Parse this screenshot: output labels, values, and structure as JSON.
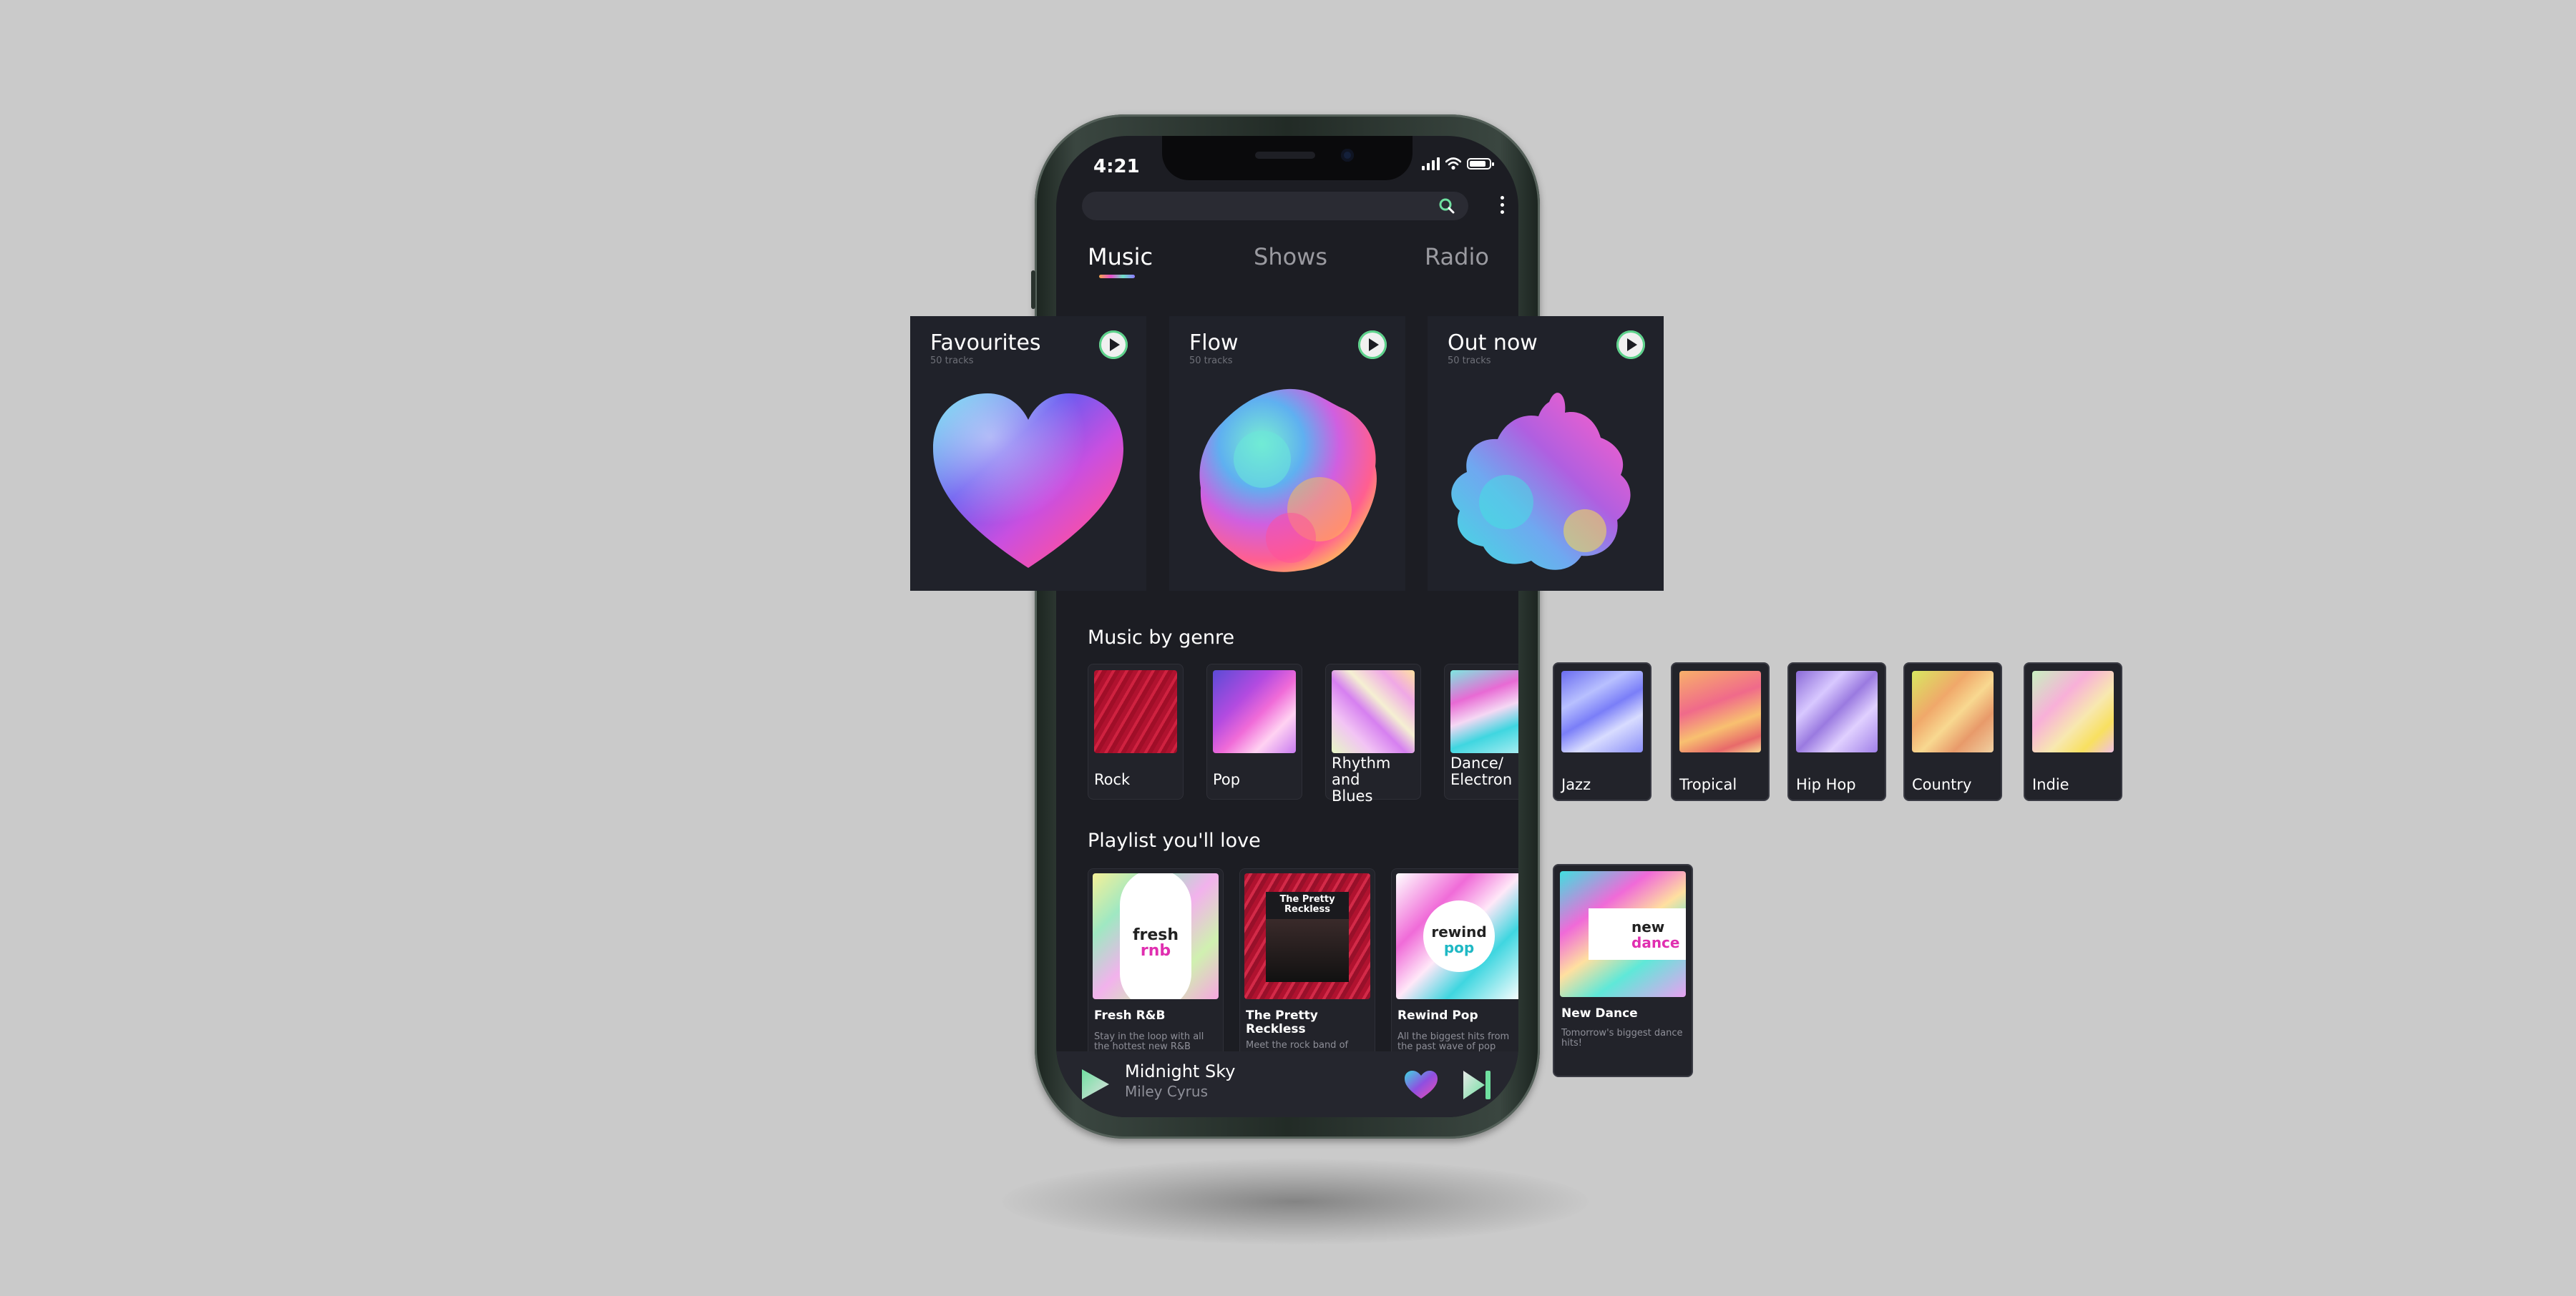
{
  "status": {
    "time": "4:21"
  },
  "tabs": [
    {
      "label": "Music",
      "active": true
    },
    {
      "label": "Shows",
      "active": false
    },
    {
      "label": "Radio",
      "active": false
    }
  ],
  "mixes": [
    {
      "title": "Favourites",
      "subtitle": "50 tracks"
    },
    {
      "title": "Flow",
      "subtitle": "50 tracks"
    },
    {
      "title": "Out now",
      "subtitle": "50 tracks"
    }
  ],
  "genre_section": {
    "title": "Music by genre",
    "items": [
      {
        "label": "Rock"
      },
      {
        "label": "Pop"
      },
      {
        "label": "Rhythm and Blues"
      },
      {
        "label": "Dance/ Electron"
      },
      {
        "label": "Jazz"
      },
      {
        "label": "Tropical"
      },
      {
        "label": "Hip Hop"
      },
      {
        "label": "Country"
      },
      {
        "label": "Indie"
      }
    ]
  },
  "playlist_section": {
    "title": "Playlist you'll love",
    "items": [
      {
        "title": "Fresh R&B",
        "description": "Stay in the loop with all the hottest new R&B",
        "art_top": "fresh",
        "art_bottom": "rnb"
      },
      {
        "title": "The Pretty Reckless",
        "description": "Meet the rock band of",
        "art_top": "The Pretty",
        "art_bottom": "Reckless"
      },
      {
        "title": "Rewind Pop",
        "description": "All the biggest hits from the past wave of pop",
        "art_top": "rewind",
        "art_bottom": "pop"
      },
      {
        "title": "New Dance",
        "description": "Tomorrow's biggest dance hits!",
        "art_top": "new",
        "art_bottom": "dance"
      }
    ]
  },
  "player": {
    "title": "Midnight Sky",
    "artist": "Miley Cyrus"
  },
  "colors": {
    "background": "#cacaca",
    "screen": "#1c1d23",
    "card": "#22232a",
    "accent": "#5bd28a"
  },
  "icons": [
    "search-icon",
    "more-icon",
    "play-icon",
    "heart-icon",
    "skip-next-icon",
    "signal-icon",
    "wifi-icon",
    "battery-icon"
  ]
}
